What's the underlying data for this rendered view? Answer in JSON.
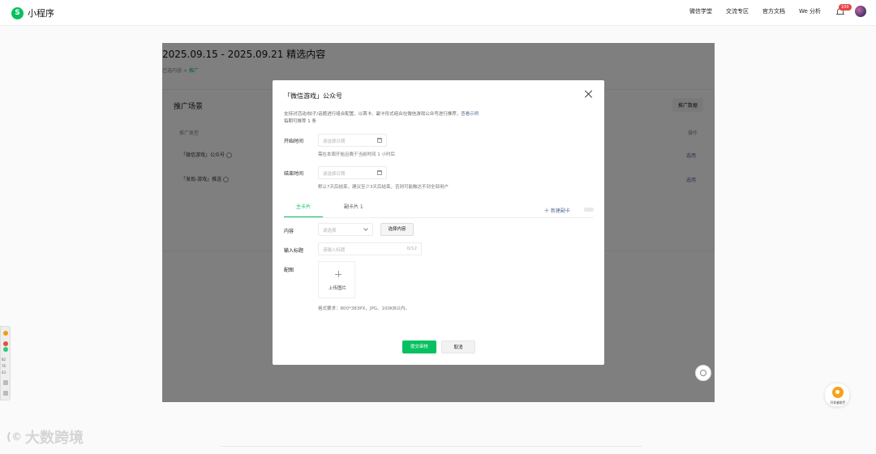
{
  "app": {
    "logo_glyph": "S",
    "name": "小程序"
  },
  "nav": {
    "items": [
      "微信学堂",
      "交流专区",
      "官方文档",
      "We 分析"
    ],
    "notification_count": "100"
  },
  "page": {
    "title": "2025.09.15 - 2025.09.21 精选内容",
    "breadcrumb": {
      "parent": "已选内容",
      "separator": ">",
      "current": "推广"
    },
    "panel": {
      "title": "推广场景",
      "button": "推广数据",
      "columns": {
        "type": "推广类型",
        "action": "操作"
      },
      "rows": [
        {
          "type": "「微信游戏」公众号",
          "action": "选用"
        },
        {
          "type": "「发现-游戏」推送",
          "action": "选用"
        }
      ]
    }
  },
  "modal": {
    "title": "「微信游戏」公众号",
    "desc_line1": "支持对活动/帖子/话题进行组合配置，以首卡、副卡形式组合在微信游戏公众号进行推荐，",
    "desc_link": "查看示例",
    "desc_line2": "每期可推荐 1 条",
    "start": {
      "label": "开始时间",
      "placeholder": "请选择日期",
      "hint": "需在本周开始且晚于当前时间 1 小时后"
    },
    "end": {
      "label": "结束时间",
      "placeholder": "请选择日期",
      "hint": "默认7天后结束，建议至少3天后结束，否则可能触达不到全部用户"
    },
    "tabs": [
      "主卡片",
      "副卡片 1"
    ],
    "add_card": "十 新建副卡",
    "content": {
      "label": "内容",
      "placeholder": "请选择",
      "button": "选择内容"
    },
    "heading": {
      "label": "输入标题",
      "placeholder": "请输入标题",
      "counter": "0/12"
    },
    "image": {
      "label": "配图",
      "upload": "上传图片",
      "format": "格式要求：800*383PX，JPG、100KB以内。"
    },
    "submit": "提交审核",
    "cancel": "取消"
  },
  "side_tools": [
    "82",
    "76",
    "43"
  ],
  "helper": {
    "label": "开发者助手"
  },
  "watermark": {
    "mark": "(©",
    "text": "大数跨境"
  },
  "colors": {
    "accent": "#07c160",
    "link": "#576b95",
    "badge": "#e84646"
  }
}
